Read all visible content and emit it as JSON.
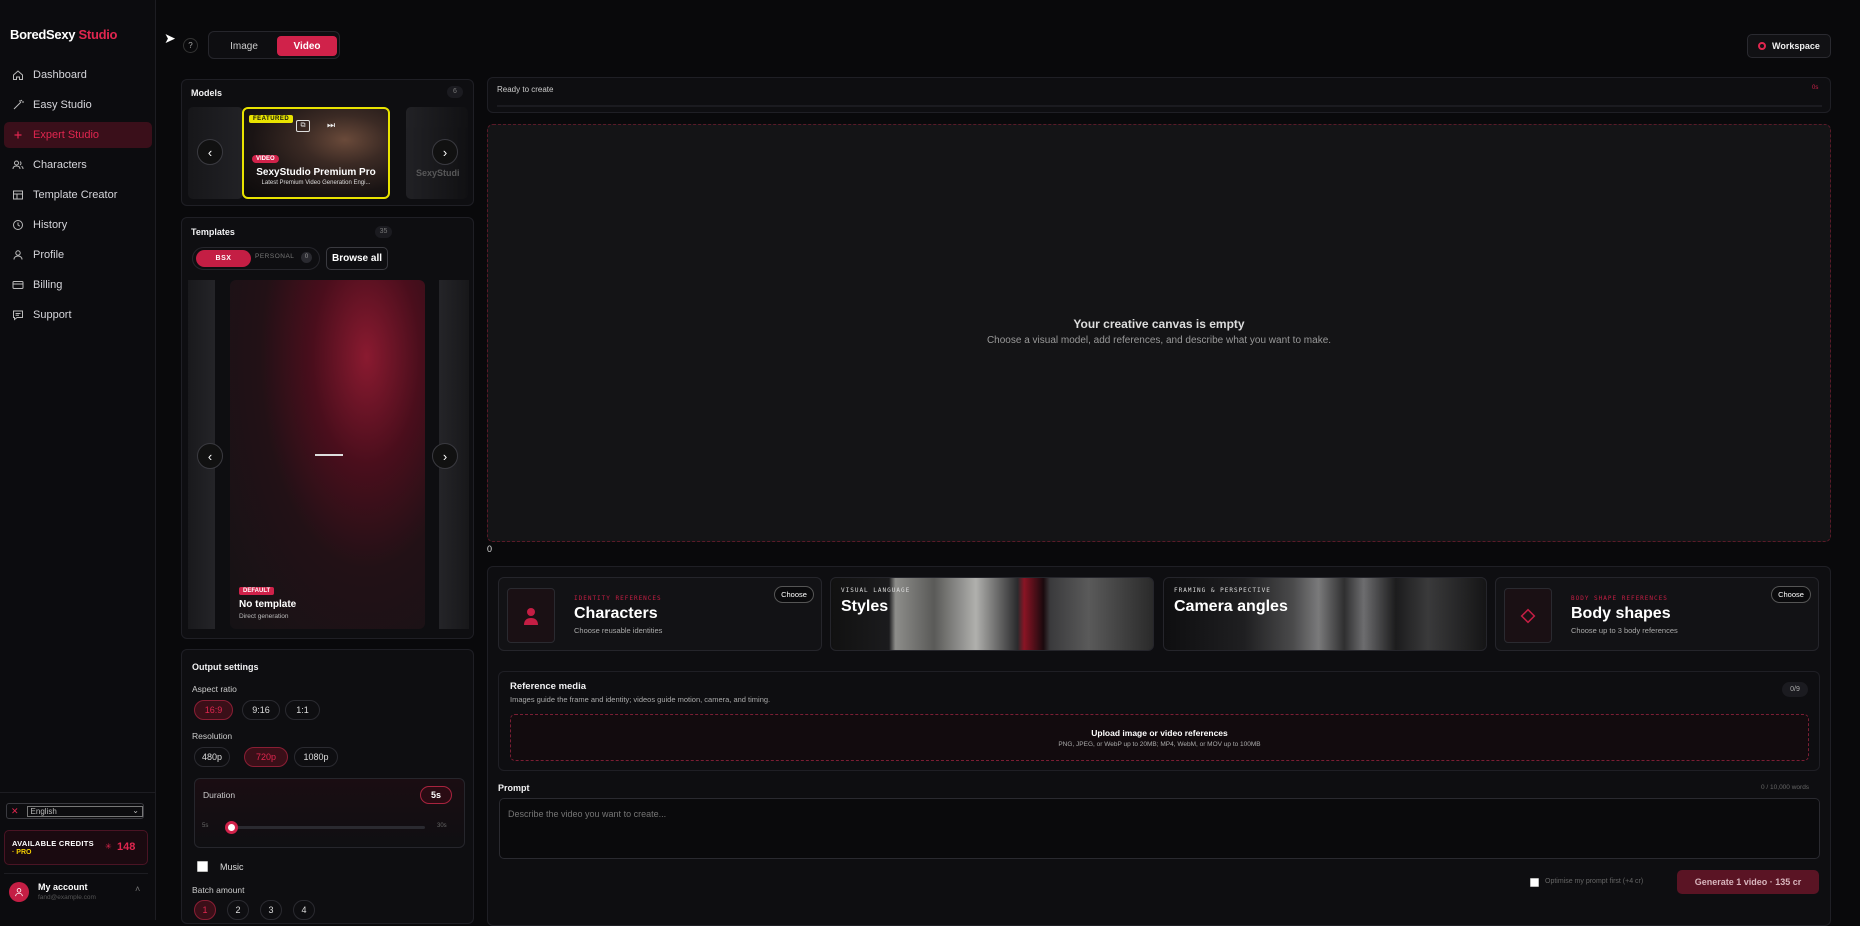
{
  "app": {
    "brand_main": "BoredSexy",
    "brand_accent": "Studio",
    "accent": "#e0264f"
  },
  "topbar": {
    "help": "?",
    "mode_tabs": [
      "Image",
      "Video"
    ],
    "active_mode": "Video",
    "workspace_label": "Workspace"
  },
  "sidebar": {
    "items": [
      {
        "label": "Dashboard",
        "icon": "home-icon"
      },
      {
        "label": "Easy Studio",
        "icon": "wand-icon"
      },
      {
        "label": "Expert Studio",
        "icon": "plus-icon",
        "active": true
      },
      {
        "label": "Characters",
        "icon": "users-icon"
      },
      {
        "label": "Template Creator",
        "icon": "template-icon"
      },
      {
        "label": "History",
        "icon": "clock-icon"
      },
      {
        "label": "Profile",
        "icon": "user-icon"
      },
      {
        "label": "Billing",
        "icon": "card-icon"
      },
      {
        "label": "Support",
        "icon": "chat-icon"
      }
    ],
    "language": "English",
    "credits": {
      "label": "AVAILABLE CREDITS",
      "plan": "· PRO",
      "amount": "148"
    },
    "account": {
      "name": "My account",
      "email": "fand@example.com"
    }
  },
  "models": {
    "title": "Models",
    "count": "6",
    "featured": {
      "badge": "FEATURED",
      "kind": "VIDEO",
      "name": "SexyStudio Premium Pro",
      "desc": "Latest Premium Video Generation Engi..."
    },
    "side_right_name": "SexyStudi"
  },
  "templates": {
    "title": "Templates",
    "count": "35",
    "tabs": [
      "BSX",
      "PERSONAL"
    ],
    "personal_count": "0",
    "browse_all": "Browse all",
    "current": {
      "badge": "DEFAULT",
      "name": "No template",
      "desc": "Direct generation"
    }
  },
  "output": {
    "title": "Output settings",
    "aspect_label": "Aspect ratio",
    "aspect_options": [
      "16:9",
      "9:16",
      "1:1"
    ],
    "aspect_selected": "16:9",
    "resolution_label": "Resolution",
    "resolution_options": [
      "480p",
      "720p",
      "1080p"
    ],
    "resolution_selected": "720p",
    "duration_label": "Duration",
    "duration_value": "5s",
    "duration_min": "5s",
    "duration_max": "30s",
    "duration_fraction": 0.0,
    "music_label": "Music",
    "music_checked": false,
    "batch_label": "Batch amount",
    "batch_options": [
      "1",
      "2",
      "3",
      "4"
    ],
    "batch_selected": "1"
  },
  "canvas": {
    "status": "Ready to create",
    "status_code": "0s",
    "empty_title": "Your creative canvas is empty",
    "empty_desc": "Choose a visual model, add references, and describe what you want to make.",
    "counter": "0"
  },
  "feature_cards": [
    {
      "tag": "IDENTITY REFERENCES",
      "title": "Characters",
      "desc": "Choose reusable identities",
      "button": "Choose"
    },
    {
      "tag": "VISUAL LANGUAGE",
      "title": "Styles"
    },
    {
      "tag": "FRAMING & PERSPECTIVE",
      "title": "Camera angles"
    },
    {
      "tag": "BODY SHAPE REFERENCES",
      "title": "Body shapes",
      "desc": "Choose up to 3 body references",
      "button": "Choose"
    }
  ],
  "reference": {
    "title": "Reference media",
    "desc": "Images guide the frame and identity; videos guide motion, camera, and timing.",
    "count": "0/9",
    "upload_title": "Upload image or video references",
    "upload_desc": "PNG, JPEG, or WebP up to 20MB; MP4, WebM, or MOV up to 100MB"
  },
  "prompt": {
    "label": "Prompt",
    "counter": "0 / 10,000 words",
    "placeholder": "Describe the video you want to create...",
    "optimise_label": "Optimise my prompt first (+4 cr)",
    "generate_label": "Generate 1 video · 135 cr"
  }
}
